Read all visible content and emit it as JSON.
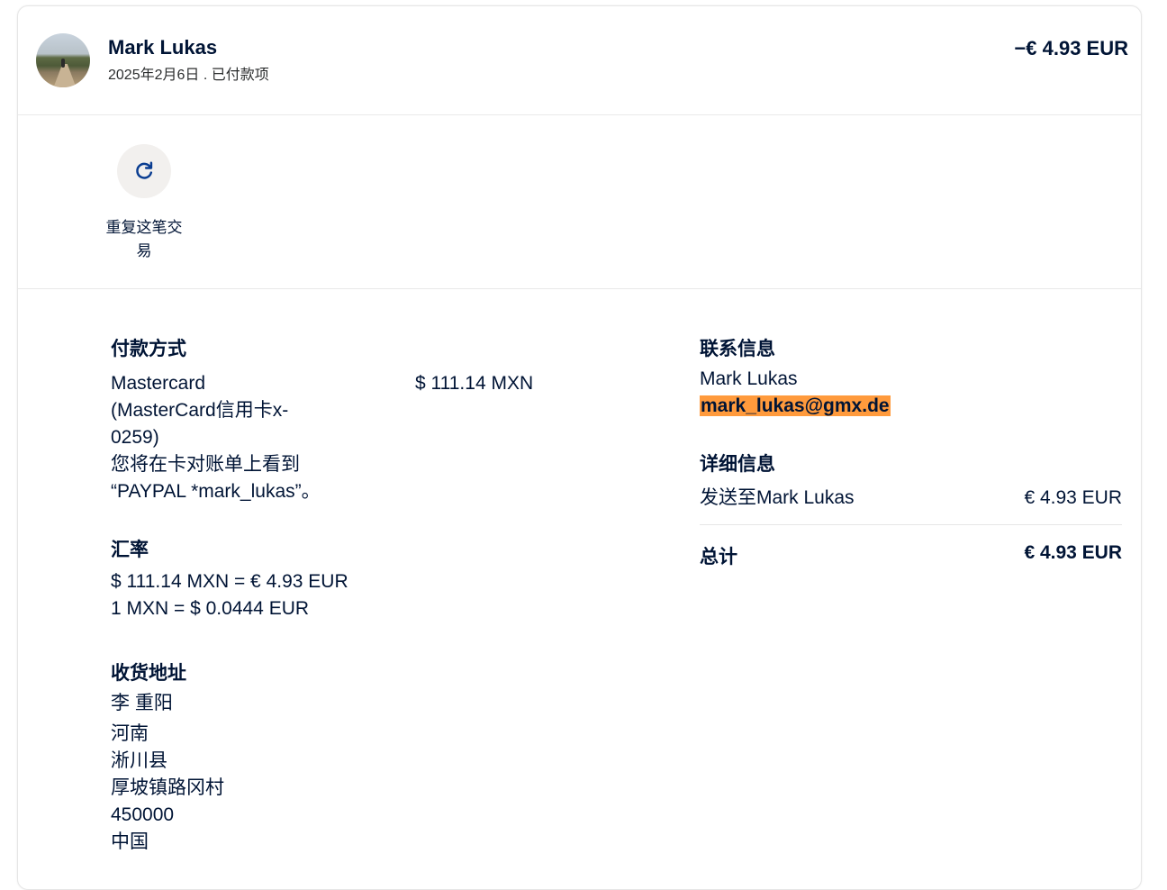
{
  "header": {
    "name": "Mark Lukas",
    "date_status": "2025年2月6日 . 已付款项",
    "amount": "−€ 4.93 EUR"
  },
  "actions": {
    "repeat_label": "重复这笔交易",
    "repeat_icon": "refresh-icon"
  },
  "payment": {
    "title": "付款方式",
    "method_lines": [
      "Mastercard",
      "(MasterCard信用卡x-",
      "0259)",
      "您将在卡对账单上看到",
      "“PAYPAL *mark_lukas”。"
    ],
    "amount": "$ 111.14 MXN"
  },
  "exchange": {
    "title": "汇率",
    "line1": "$ 111.14 MXN = € 4.93 EUR",
    "line2": "1 MXN = $ 0.0444 EUR"
  },
  "shipping": {
    "title": "收货地址",
    "lines": [
      "李 重阳",
      "河南",
      "淅川县",
      "厚坡镇路冈村",
      "450000",
      "中国"
    ]
  },
  "contact": {
    "title": "联系信息",
    "name": "Mark Lukas",
    "email": "mark_lukas@gmx.de"
  },
  "details": {
    "title": "详细信息",
    "sent_label": "发送至Mark Lukas",
    "sent_amount": "€ 4.93 EUR",
    "total_label": "总计",
    "total_amount": "€ 4.93 EUR"
  },
  "colors": {
    "text": "#001435",
    "email_highlight": "#ff9a3c",
    "icon": "#0a3d91"
  }
}
